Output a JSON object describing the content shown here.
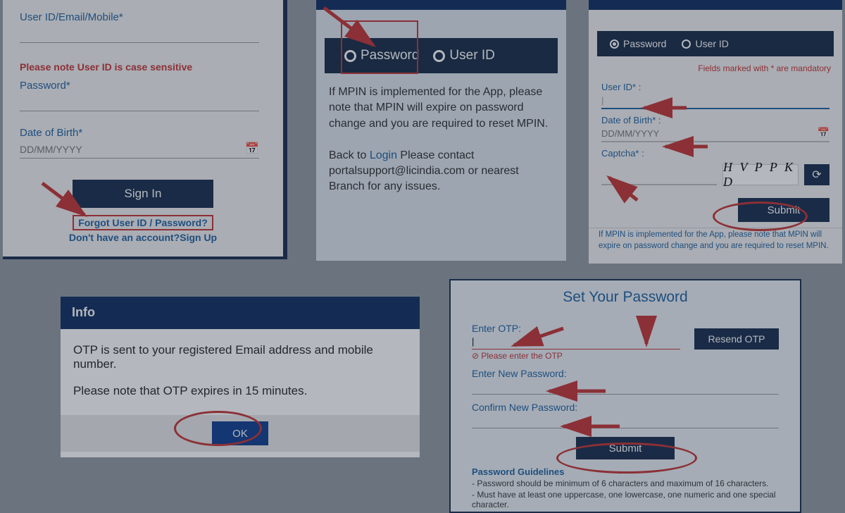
{
  "panel1": {
    "userid_label": "User ID/Email/Mobile*",
    "note": "Please note User ID is case sensitive",
    "password_label": "Password*",
    "dob_label": "Date of Birth*",
    "dob_placeholder": "DD/MM/YYYY",
    "signin": "Sign In",
    "forgot": "Forgot User ID / Password?",
    "signup": "Don't have an account?Sign Up"
  },
  "panel2": {
    "tab_password": "Password",
    "tab_userid": "User ID",
    "msg1": "If MPIN is implemented for the App, please note that MPIN will expire on password change and you are required to reset MPIN.",
    "back_prefix": "Back to ",
    "login_link": "Login",
    "back_suffix": "  Please contact portalsupport@licindia.com or nearest Branch for any issues."
  },
  "panel3": {
    "tab_password": "Password",
    "tab_userid": "User ID",
    "mandatory": "Fields marked with * are mandatory",
    "userid_label": "User ID* :",
    "dob_label": "Date of Birth* :",
    "dob_placeholder": "DD/MM/YYYY",
    "captcha_label": "Captcha* :",
    "captcha_text": "H V P P K D",
    "submit": "Submit",
    "mpin_note": "If MPIN is implemented for the App, please note that MPIN will expire on password change and you are required to reset MPIN."
  },
  "panel4": {
    "title": "Info",
    "line1": "OTP is sent to your registered Email address and mobile number.",
    "line2": "Please note that OTP expires in 15 minutes.",
    "ok": "OK"
  },
  "panel5": {
    "title": "Set Your Password",
    "enter_otp": "Enter OTP:",
    "resend": "Resend OTP",
    "otp_error": "Please enter the OTP",
    "new_pwd": "Enter New Password:",
    "confirm_pwd": "Confirm New Password:",
    "submit": "Submit",
    "guidelines_h": "Password Guidelines",
    "g1": "- Password should be minimum of 6 characters and maximum of 16 characters.",
    "g2": "- Must have at least one uppercase, one lowercase, one numeric and one special character."
  }
}
